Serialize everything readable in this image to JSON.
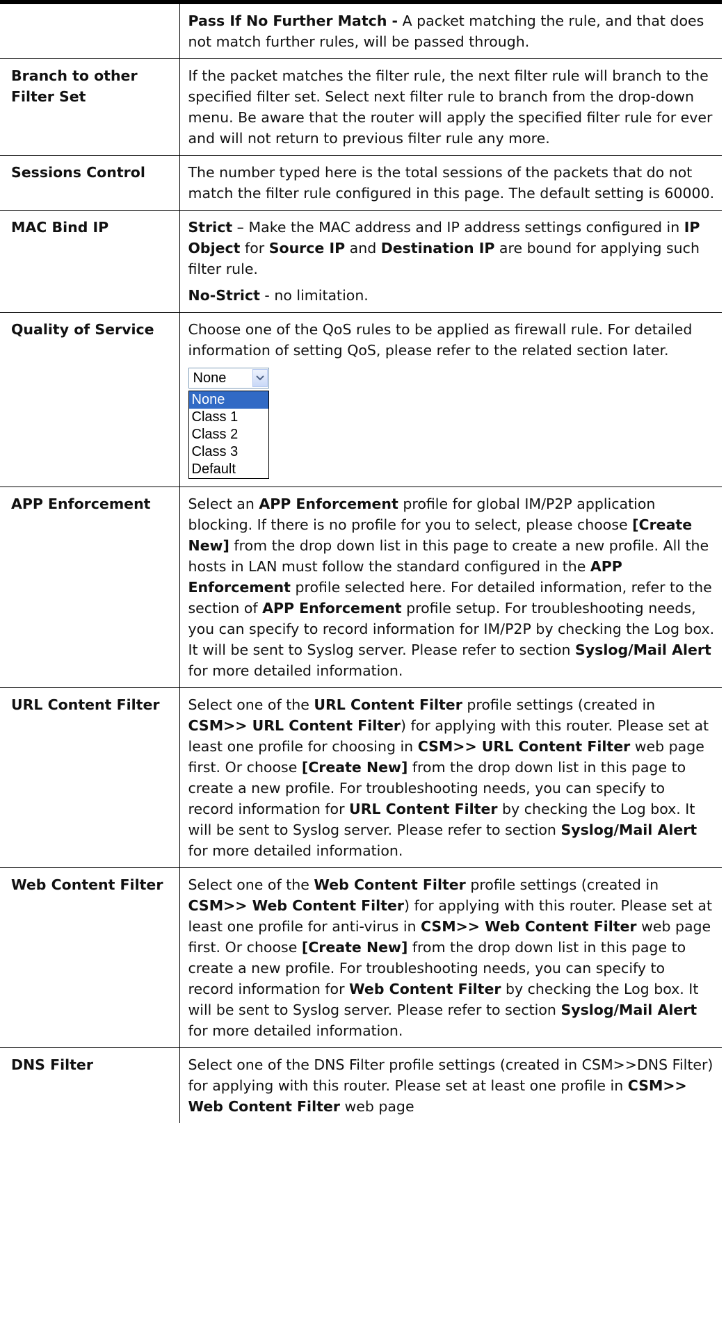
{
  "rows": [
    {
      "term": "",
      "desc": [
        [
          {
            "b": true,
            "t": "Pass If No Further Match -"
          },
          {
            "t": " A packet matching the rule, and that does not match further rules, will be passed through."
          }
        ]
      ]
    },
    {
      "term": "Branch to other Filter Set",
      "desc": [
        [
          {
            "t": "If the packet matches the filter rule, the next filter rule will branch to the specified filter set. Select next filter rule to branch from the drop-down menu. Be aware that the router will apply the specified filter rule for ever and will not return to previous filter rule any more."
          }
        ]
      ]
    },
    {
      "term": "Sessions Control",
      "desc": [
        [
          {
            "t": "The number typed here is the total sessions of the packets that do not match the filter rule configured in this page. The default setting is 60000."
          }
        ]
      ]
    },
    {
      "term": "MAC Bind IP",
      "desc": [
        [
          {
            "b": true,
            "t": "Strict"
          },
          {
            "t": " – Make the MAC address and IP address settings configured in "
          },
          {
            "b": true,
            "t": "IP Object"
          },
          {
            "t": " for "
          },
          {
            "b": true,
            "t": "Source IP"
          },
          {
            "t": " and "
          },
          {
            "b": true,
            "t": "Destination IP"
          },
          {
            "t": " are bound for applying such filter rule."
          }
        ],
        [
          {
            "b": true,
            "t": "No-Strict"
          },
          {
            "t": " - no limitation."
          }
        ]
      ]
    },
    {
      "term": "Quality of Service",
      "desc": [
        [
          {
            "t": "Choose one of the QoS rules to be applied as firewall rule. For detailed information of setting QoS, please refer to the related section later."
          }
        ]
      ],
      "widget": true
    },
    {
      "term": "APP Enforcement",
      "desc": [
        [
          {
            "t": "Select an "
          },
          {
            "b": true,
            "t": "APP Enforcement"
          },
          {
            "t": " profile for global IM/P2P application blocking. If there is no profile for you to select, please choose "
          },
          {
            "b": true,
            "t": "[Create New]"
          },
          {
            "t": " from the drop down list in this page to create a new profile. All the hosts in LAN must follow the standard configured in the "
          },
          {
            "b": true,
            "t": "APP Enforcement"
          },
          {
            "t": " profile selected here. For detailed information, refer to the section of "
          },
          {
            "b": true,
            "t": "APP Enforcement"
          },
          {
            "t": " profile setup. For troubleshooting needs, you can specify to record information for IM/P2P by checking the Log box. It will be sent to Syslog server. Please refer to section "
          },
          {
            "b": true,
            "t": "Syslog/Mail Alert"
          },
          {
            "t": " for more detailed information."
          }
        ]
      ]
    },
    {
      "term": "URL Content Filter",
      "desc": [
        [
          {
            "t": "Select one of the "
          },
          {
            "b": true,
            "t": "URL Content Filter"
          },
          {
            "t": " profile settings (created in "
          },
          {
            "b": true,
            "t": "CSM>> URL Content Filter"
          },
          {
            "t": ") for applying with this router. Please set at least one profile for choosing in "
          },
          {
            "b": true,
            "t": "CSM>> URL Content Filter"
          },
          {
            "t": " web page first. Or choose "
          },
          {
            "b": true,
            "t": "[Create New]"
          },
          {
            "t": " from the drop down list in this page to create a new profile. For troubleshooting needs, you can specify to record information for "
          },
          {
            "b": true,
            "t": "URL Content Filter"
          },
          {
            "t": " by checking the Log box. It will be sent to Syslog server. Please refer to section "
          },
          {
            "b": true,
            "t": "Syslog/Mail Alert"
          },
          {
            "t": " for more detailed information."
          }
        ]
      ]
    },
    {
      "term": "Web Content Filter",
      "desc": [
        [
          {
            "t": "Select one of the "
          },
          {
            "b": true,
            "t": "Web Content Filter"
          },
          {
            "t": " profile settings (created in "
          },
          {
            "b": true,
            "t": "CSM>> Web Content Filter"
          },
          {
            "t": ") for applying with this router. Please set at least one profile for anti-virus in "
          },
          {
            "b": true,
            "t": "CSM>> Web Content Filter"
          },
          {
            "t": " web page first. Or choose "
          },
          {
            "b": true,
            "t": "[Create New]"
          },
          {
            "t": " from the drop down list in this page to create a new profile. For troubleshooting needs, you can specify to record information for "
          },
          {
            "b": true,
            "t": "Web Content Filter"
          },
          {
            "t": " by checking the Log box. It will be sent to Syslog server. Please refer to section "
          },
          {
            "b": true,
            "t": "Syslog/Mail Alert"
          },
          {
            "t": " for more detailed information."
          }
        ]
      ]
    },
    {
      "term": "DNS Filter",
      "desc": [
        [
          {
            "t": "Select one of the DNS Filter profile settings (created in CSM>>DNS Filter) for applying with this router. Please set at least one profile in "
          },
          {
            "b": true,
            "t": "CSM>> Web Content Filter"
          },
          {
            "t": " web page"
          }
        ]
      ]
    }
  ],
  "qos_select": {
    "value": "None",
    "options": [
      "None",
      "Class 1",
      "Class 2",
      "Class 3",
      "Default"
    ],
    "selected_index": 0
  },
  "icons": {
    "dropdown_arrow": "chevron-down-icon"
  },
  "colors": {
    "selection_bg": "#316ac5",
    "select_border": "#7f9db9",
    "rule": "#000000"
  }
}
